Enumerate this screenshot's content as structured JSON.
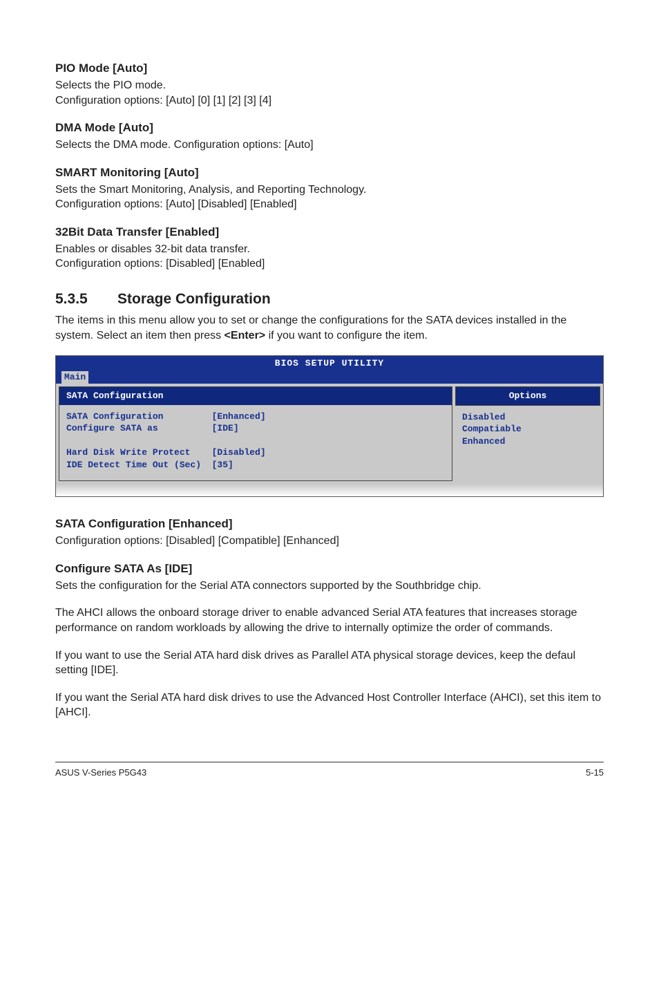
{
  "s1": {
    "heading": "PIO Mode [Auto]",
    "p": "Selects the PIO mode.\nConfiguration options: [Auto] [0] [1] [2] [3] [4]"
  },
  "s2": {
    "heading": "DMA Mode [Auto]",
    "p": "Selects the DMA mode. Configuration options: [Auto]"
  },
  "s3": {
    "heading": "SMART Monitoring [Auto]",
    "p": "Sets the Smart Monitoring, Analysis, and Reporting Technology.\nConfiguration options: [Auto] [Disabled] [Enabled]"
  },
  "s4": {
    "heading": "32Bit Data Transfer [Enabled]",
    "p": "Enables or disables 32-bit data transfer.\nConfiguration options: [Disabled] [Enabled]"
  },
  "sec535": {
    "num": "5.3.5",
    "title": "Storage Configuration",
    "p": "The items in this menu allow you to set or change the configurations for the SATA devices installed in the system. Select an item then press <Enter> if you want to configure the item.",
    "enter": "<Enter>"
  },
  "bios": {
    "title": "BIOS SETUP UTILITY",
    "tab": "Main",
    "left_header": "SATA Configuration",
    "left_lines": "SATA Configuration         [Enhanced]\nConfigure SATA as          [IDE]\n\nHard Disk Write Protect    [Disabled]\nIDE Detect Time Out (Sec)  [35]",
    "options_header": "Options",
    "options": [
      "Disabled",
      "Compatiable",
      "Enhanced"
    ]
  },
  "s5": {
    "heading": "SATA Configuration [Enhanced]",
    "p": "Configuration options: [Disabled] [Compatible] [Enhanced]"
  },
  "s6": {
    "heading": "Configure SATA As [IDE]",
    "p1": "Sets the configuration for the Serial ATA connectors supported by the Southbridge chip.",
    "p2": "The AHCI allows the onboard storage driver to enable advanced Serial ATA features that increases storage performance on random workloads by allowing the drive to internally optimize the order of commands.",
    "p3": "If you want to use the Serial ATA hard disk drives as Parallel ATA physical storage devices, keep the defaul setting [IDE].",
    "p4": "If you want the Serial ATA hard disk drives to use the Advanced Host Controller Interface (AHCI), set this item to [AHCI]."
  },
  "footer": {
    "left": "ASUS V-Series P5G43",
    "right": "5-15"
  }
}
